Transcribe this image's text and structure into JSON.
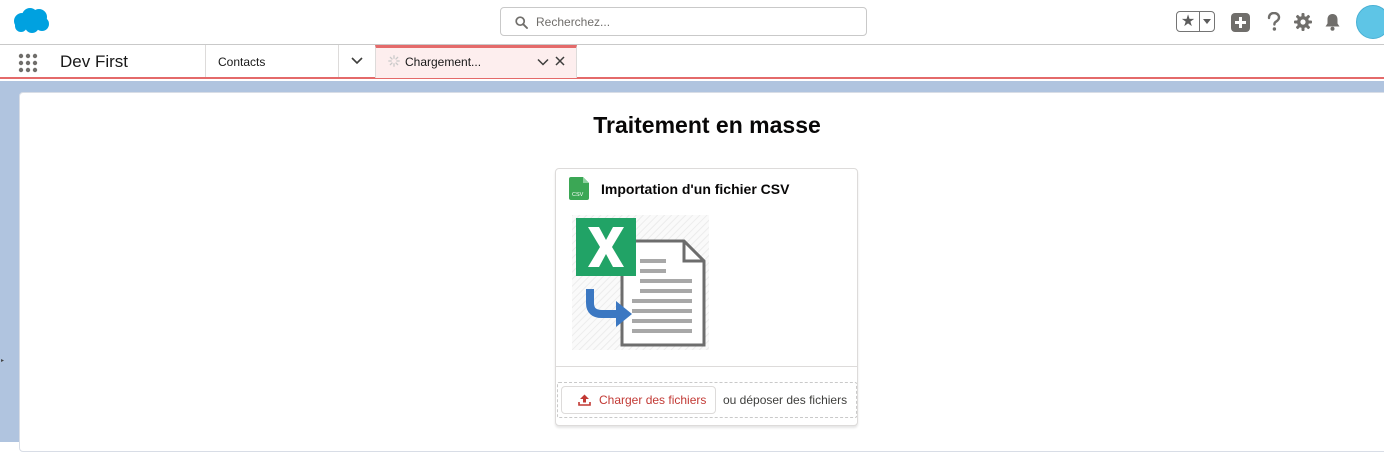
{
  "header": {
    "search_placeholder": "Recherchez...",
    "favorites_star": "★",
    "icons": [
      "salesforce-cloud-logo",
      "search-icon",
      "star-icon",
      "chevron-down-icon",
      "plus-icon",
      "help-icon",
      "gear-icon",
      "bell-icon",
      "avatar"
    ],
    "colors": {
      "brand": "#00a1e0",
      "avatar": "#5ec5e6"
    }
  },
  "nav": {
    "app_name": "Dev First",
    "items": [
      {
        "label": "Contacts"
      }
    ],
    "active_tab": {
      "label": "Chargement..."
    },
    "colors": {
      "active_accent": "#e46a6a",
      "active_bg": "#fdeeee"
    }
  },
  "page": {
    "title": "Traitement en masse"
  },
  "import_card": {
    "title": "Importation d'un fichier CSV",
    "file_icon_label": "CSV",
    "upload_button": "Charger des fichiers",
    "drop_label": "ou déposer des fichiers",
    "colors": {
      "excel_green": "#21a366",
      "upload_red": "#c23934"
    }
  }
}
